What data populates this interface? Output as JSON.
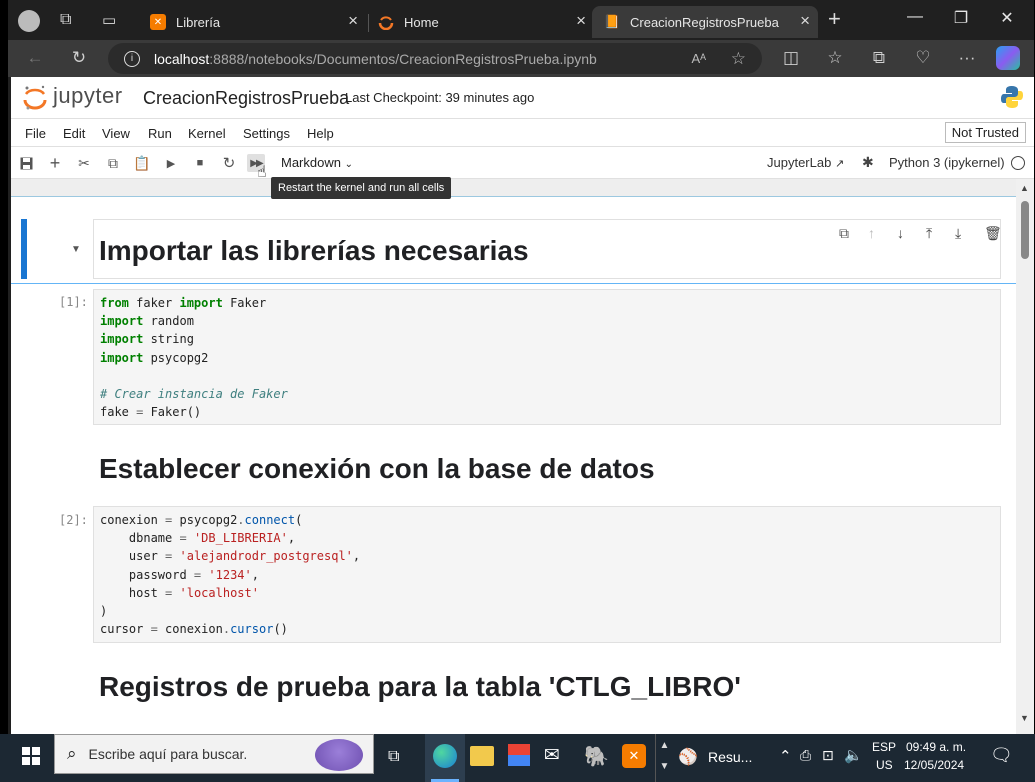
{
  "browser": {
    "tabs": [
      {
        "label": "Librería"
      },
      {
        "label": "Home"
      },
      {
        "label": "CreacionRegistrosPrueba"
      }
    ],
    "url_host": "localhost",
    "url_path": ":8888/notebooks/Documentos/CreacionRegistrosPrueba.ipynb"
  },
  "jupyter": {
    "logo_text": "jupyter",
    "notebook_name": "CreacionRegistrosPrueba",
    "checkpoint": "Last Checkpoint: 39 minutes ago",
    "menu": [
      "File",
      "Edit",
      "View",
      "Run",
      "Kernel",
      "Settings",
      "Help"
    ],
    "trusted": "Not Trusted",
    "cell_type": "Markdown",
    "jupyterlab_link": "JupyterLab",
    "kernel_name": "Python 3 (ipykernel)",
    "tooltip": "Restart the kernel and run all cells"
  },
  "cells": {
    "h1": "Importar las librerías necesarias",
    "p1": "[1]:",
    "h2": "Establecer conexión con la base de datos",
    "p2": "[2]:",
    "h3": "Registros de prueba para la tabla 'CTLG_LIBRO'"
  },
  "taskbar": {
    "search_placeholder": "Escribe aquí para buscar.",
    "app_label": "Resu...",
    "lang1": "ESP",
    "lang2": "US",
    "time": "09:49 a. m.",
    "date": "12/05/2024"
  }
}
